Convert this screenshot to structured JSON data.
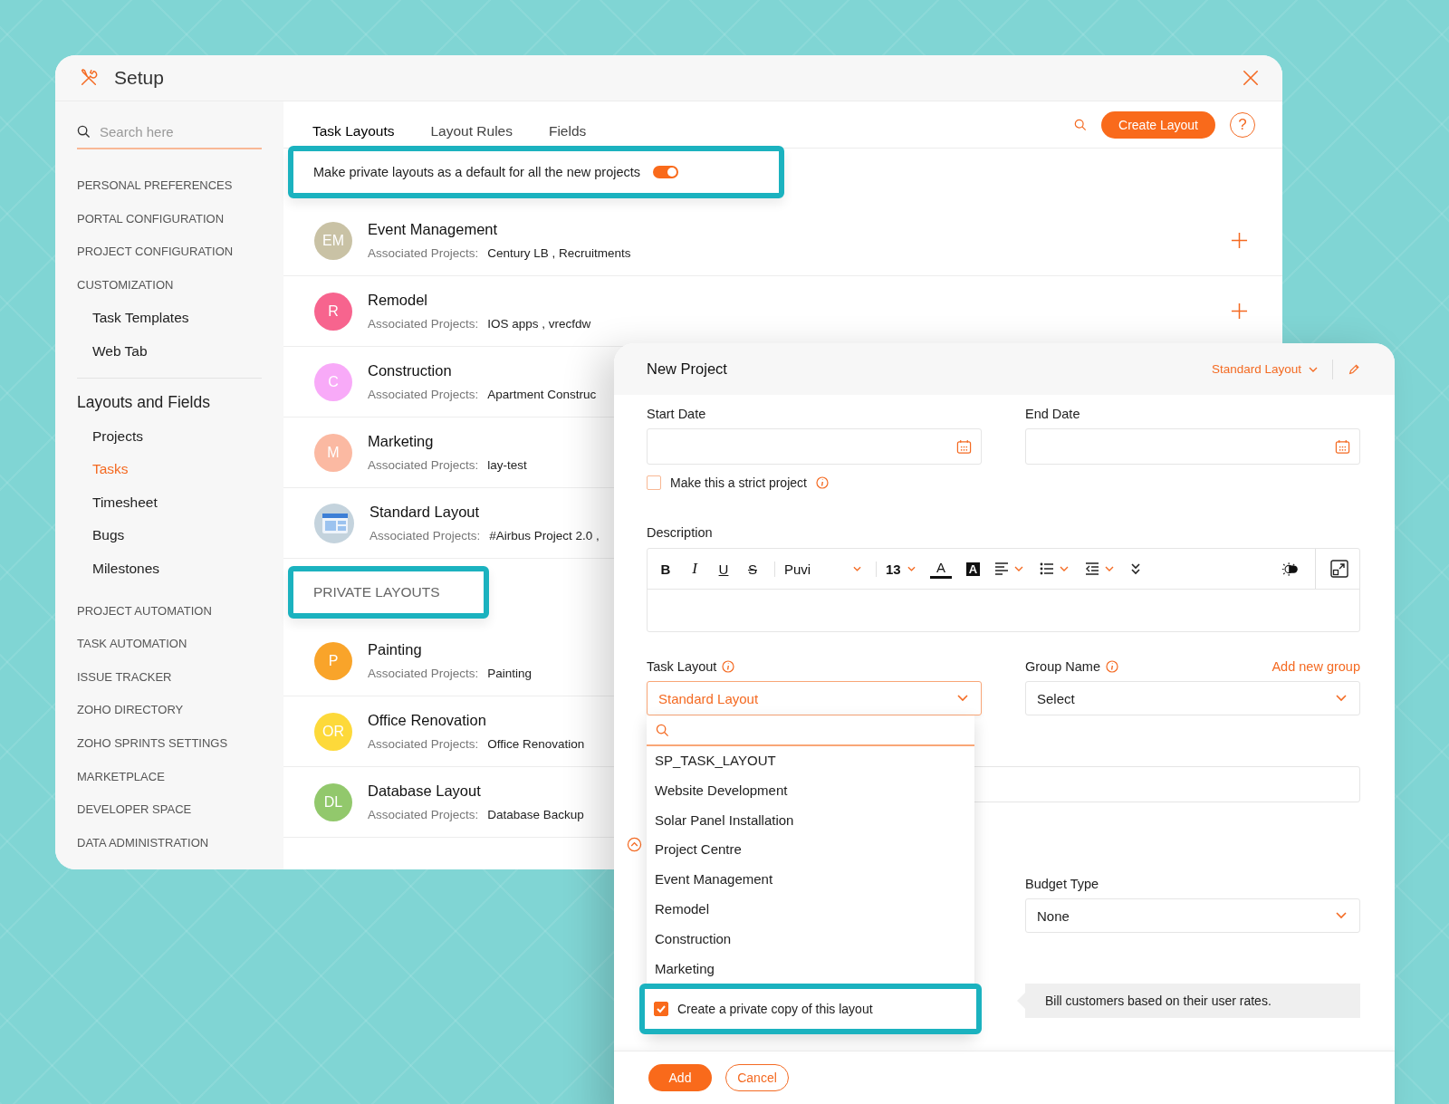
{
  "setup": {
    "title": "Setup",
    "search": {
      "placeholder": "Search here"
    },
    "sidebar": {
      "items": [
        {
          "label": "PERSONAL PREFERENCES",
          "kind": "section",
          "selected": false
        },
        {
          "label": "PORTAL CONFIGURATION",
          "kind": "section",
          "selected": false
        },
        {
          "label": "PROJECT CONFIGURATION",
          "kind": "section",
          "selected": false
        },
        {
          "label": "CUSTOMIZATION",
          "kind": "section",
          "selected": false
        },
        {
          "label": "Task Templates",
          "kind": "sub",
          "selected": false
        },
        {
          "label": "Web Tab",
          "kind": "sub",
          "selected": false
        },
        {
          "label": "Layouts and Fields",
          "kind": "group",
          "selected": false
        },
        {
          "label": "Projects",
          "kind": "sub",
          "selected": false
        },
        {
          "label": "Tasks",
          "kind": "sub",
          "selected": true
        },
        {
          "label": "Timesheet",
          "kind": "sub",
          "selected": false
        },
        {
          "label": "Bugs",
          "kind": "sub",
          "selected": false
        },
        {
          "label": "Milestones",
          "kind": "sub",
          "selected": false
        },
        {
          "label": "PROJECT AUTOMATION",
          "kind": "section",
          "selected": false
        },
        {
          "label": "TASK AUTOMATION",
          "kind": "section",
          "selected": false
        },
        {
          "label": "ISSUE TRACKER",
          "kind": "section",
          "selected": false
        },
        {
          "label": "ZOHO DIRECTORY",
          "kind": "section",
          "selected": false
        },
        {
          "label": "ZOHO SPRINTS SETTINGS",
          "kind": "section",
          "selected": false
        },
        {
          "label": "MARKETPLACE",
          "kind": "section",
          "selected": false
        },
        {
          "label": "DEVELOPER SPACE",
          "kind": "section",
          "selected": false
        },
        {
          "label": "DATA ADMINISTRATION",
          "kind": "section",
          "selected": false
        }
      ]
    },
    "tabs": [
      {
        "label": "Task Layouts",
        "selected": true
      },
      {
        "label": "Layout Rules",
        "selected": false
      },
      {
        "label": "Fields",
        "selected": false
      }
    ],
    "create_button": "Create Layout",
    "help": "?",
    "banner": {
      "text": "Make private layouts as a default for all the new projects",
      "on": true
    },
    "layouts": [
      {
        "name": "Event Management",
        "assoc_label": "Associated Projects:",
        "projects": "Century LB , Recruitments",
        "avatar": {
          "kind": "initials",
          "text": "EM",
          "color": "#c9c2a5"
        },
        "add_icon": true
      },
      {
        "name": "Remodel",
        "assoc_label": "Associated Projects:",
        "projects": "IOS apps , vrecfdw",
        "avatar": {
          "kind": "initials",
          "text": "R",
          "color": "#f7648e"
        },
        "add_icon": true
      },
      {
        "name": "Construction",
        "assoc_label": "Associated Projects:",
        "projects": "Apartment Construc",
        "avatar": {
          "kind": "initials",
          "text": "C",
          "color": "#f8aaf8"
        },
        "add_icon": false
      },
      {
        "name": "Marketing",
        "assoc_label": "Associated Projects:",
        "projects": "lay-test",
        "avatar": {
          "kind": "initials",
          "text": "M",
          "color": "#fbb9a2"
        },
        "add_icon": false
      },
      {
        "name": "Standard Layout",
        "assoc_label": "Associated Projects:",
        "projects": "#Airbus Project 2.0 ,",
        "avatar": {
          "kind": "icon"
        },
        "add_icon": false
      }
    ],
    "private_header": "PRIVATE LAYOUTS",
    "private_layouts": [
      {
        "name": "Painting",
        "assoc_label": "Associated Projects:",
        "projects": "Painting",
        "avatar": {
          "kind": "initials",
          "text": "P",
          "color": "#f9a42a"
        }
      },
      {
        "name": "Office Renovation",
        "assoc_label": "Associated Projects:",
        "projects": "Office Renovation",
        "avatar": {
          "kind": "initials",
          "text": "OR",
          "color": "#fdd93a"
        }
      },
      {
        "name": "Database Layout",
        "assoc_label": "Associated Projects:",
        "projects": "Database Backup",
        "avatar": {
          "kind": "initials",
          "text": "DL",
          "color": "#92c86c"
        }
      }
    ]
  },
  "new_project": {
    "title": "New Project",
    "layout_menu": "Standard Layout",
    "start_date": {
      "label": "Start Date"
    },
    "end_date": {
      "label": "End Date"
    },
    "strict": {
      "label": "Make this a strict project",
      "checked": false
    },
    "description": {
      "label": "Description",
      "toolbar": [
        {
          "kind": "bold",
          "label": "B"
        },
        {
          "kind": "italic",
          "label": "I"
        },
        {
          "kind": "underline",
          "label": "U"
        },
        {
          "kind": "strike",
          "label": "S"
        },
        {
          "kind": "font",
          "label": "Puvi"
        },
        {
          "kind": "size",
          "label": "13"
        },
        {
          "kind": "color",
          "label": "A"
        },
        {
          "kind": "highlight",
          "label": "A"
        },
        {
          "kind": "align"
        },
        {
          "kind": "list"
        },
        {
          "kind": "indent"
        },
        {
          "kind": "more"
        }
      ]
    },
    "task_layout": {
      "label": "Task Layout",
      "value": "Standard Layout",
      "expanded": true,
      "options": [
        "SP_TASK_LAYOUT",
        "Website Development",
        "Solar Panel Installation",
        "Project Centre",
        "Event Management",
        "Remodel",
        "Construction",
        "Marketing"
      ],
      "private_copy": {
        "label": "Create a private copy of this layout",
        "checked": true
      }
    },
    "group_name": {
      "label": "Group Name",
      "link": "Add new group",
      "value": "Select"
    },
    "budget_type": {
      "label": "Budget Type",
      "value": "None"
    },
    "hint": "Bill customers based on their user rates.",
    "add_button": "Add",
    "cancel_button": "Cancel"
  }
}
